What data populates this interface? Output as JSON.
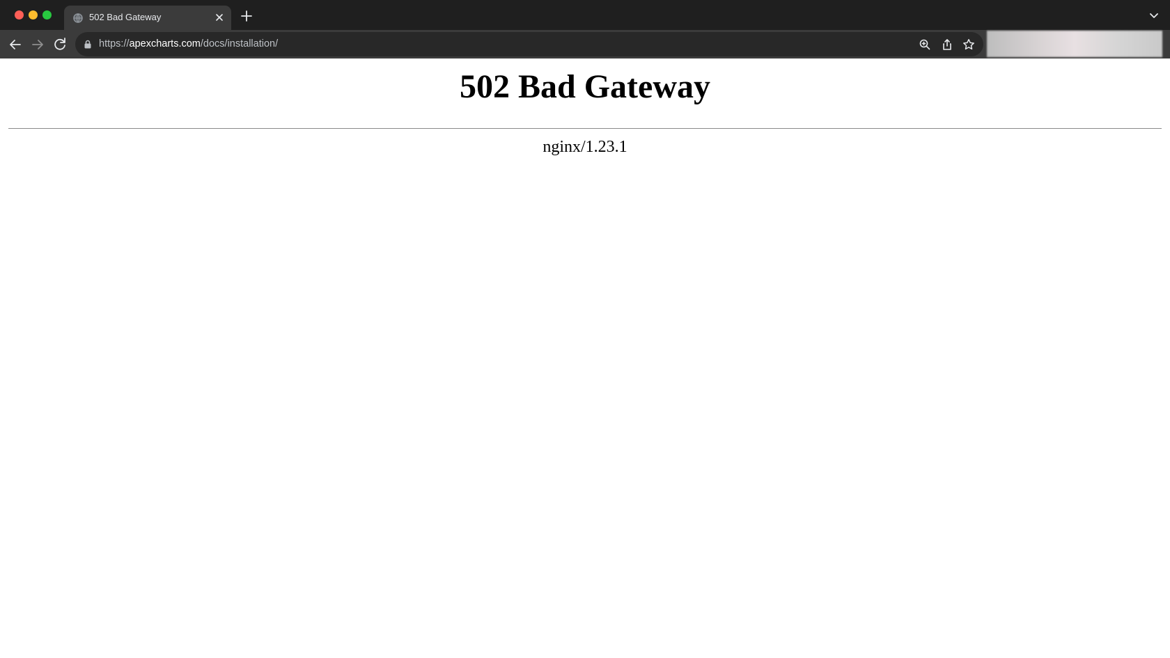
{
  "browser": {
    "tab": {
      "title": "502 Bad Gateway",
      "favicon": "globe-icon",
      "close_icon": "close-icon"
    },
    "new_tab_icon": "plus-icon",
    "tab_menu_icon": "chevron-down-icon",
    "toolbar": {
      "back_icon": "arrow-left-icon",
      "forward_icon": "arrow-right-icon",
      "reload_icon": "reload-icon",
      "url_scheme": "https://",
      "url_host": "apexcharts.com",
      "url_path": "/docs/installation/",
      "lock_icon": "lock-icon",
      "zoom_icon": "zoom-in-icon",
      "share_icon": "share-icon",
      "bookmark_icon": "star-icon"
    },
    "colors": {
      "close": "#fe5f57",
      "minimize": "#febc2e",
      "maximize": "#28c840",
      "tabstrip": "#1f1f1f",
      "toolbar": "#3b3b3b",
      "omnibox": "#282828"
    }
  },
  "page": {
    "heading": "502 Bad Gateway",
    "server": "nginx/1.23.1"
  }
}
